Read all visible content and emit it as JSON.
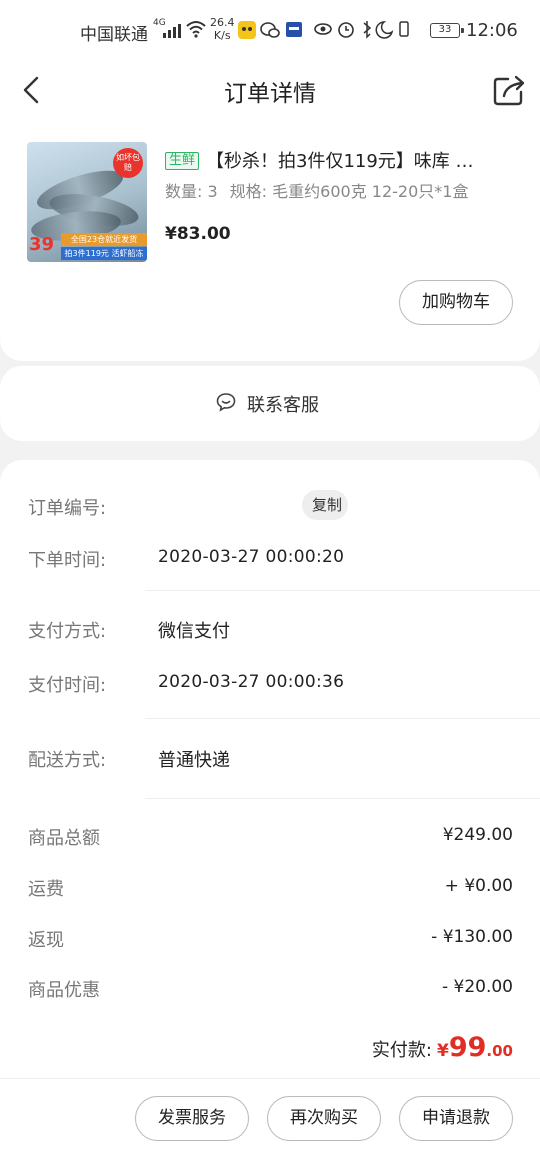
{
  "status_bar": {
    "carrier": "中国联通",
    "network": "4G",
    "speed_value": "26.4",
    "speed_unit": "K/s",
    "battery": "33",
    "time": "12:06"
  },
  "header": {
    "title": "订单详情",
    "back_icon": "chevron-left-icon",
    "share_icon": "share-icon"
  },
  "product": {
    "tag": "生鲜",
    "title": "【秒杀！拍3件仅119元】味库 …",
    "quantity": "数量: 3",
    "spec": "规格: 毛重约600克 12-20只*1盒",
    "price": "¥83.00",
    "image_badge": "如坏包赔",
    "image_price": "39",
    "image_strip_1": "全国23仓就近发货",
    "image_strip_2": "拍3件119元 活虾船冻",
    "cart_button": "加购物车"
  },
  "service": {
    "label": "联系客服",
    "icon": "chat-bubble-icon"
  },
  "order_info": {
    "order_number_label": "订单编号:",
    "copy_button": "复制",
    "order_time_label": "下单时间:",
    "order_time": "2020-03-27 00:00:20",
    "pay_method_label": "支付方式:",
    "pay_method": "微信支付",
    "pay_time_label": "支付时间:",
    "pay_time": "2020-03-27 00:00:36",
    "delivery_label": "配送方式:",
    "delivery": "普通快递"
  },
  "amounts": {
    "subtotal_label": "商品总额",
    "subtotal": "¥249.00",
    "shipping_label": "运费",
    "shipping": "+ ¥0.00",
    "cashback_label": "返现",
    "cashback": "- ¥130.00",
    "discount_label": "商品优惠",
    "discount": "- ¥20.00",
    "paid_label": "实付款:",
    "paid_currency": "¥",
    "paid_integer": "99",
    "paid_decimal": ".00"
  },
  "actions": {
    "invoice": "发票服务",
    "rebuy": "再次购买",
    "refund": "申请退款"
  },
  "colors": {
    "accent_red": "#e02e24",
    "fresh_green": "#2fb463",
    "page_bg": "#f2f2f2"
  }
}
